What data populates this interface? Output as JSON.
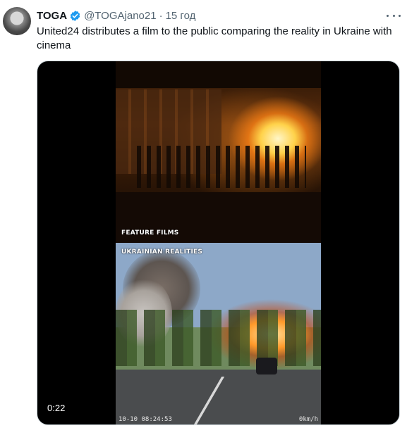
{
  "author": {
    "name": "TOGA",
    "handle": "@TOGAjano21",
    "separator": "·",
    "time": "15 год",
    "verified_icon": "verified-badge-icon",
    "verified_color": "#1d9bf0"
  },
  "tweet": {
    "text": "United24 distributes a film to the public comparing the reality in Ukraine with cinema"
  },
  "video": {
    "duration": "0:22",
    "label_top": "FEATURE FILMS",
    "label_bottom": "UKRAINIAN REALITIES",
    "timestamp": "10-10  08:24:53",
    "speed": "0km/h",
    "corner_glyph": "ai"
  }
}
